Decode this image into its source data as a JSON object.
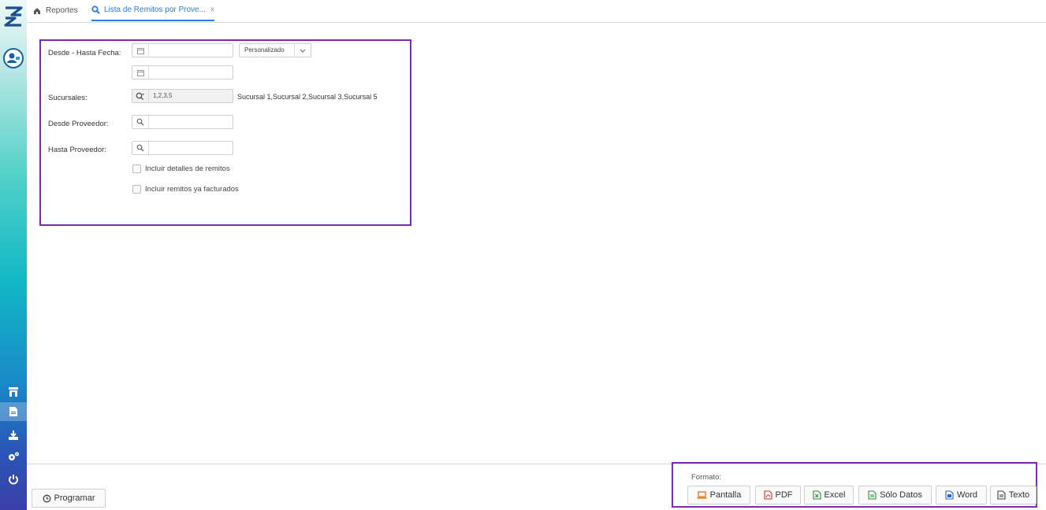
{
  "tabs": {
    "home_label": "Reportes",
    "active_label": "Lista de Remitos por Prove...",
    "close_symbol": "x"
  },
  "form": {
    "fecha_label": "Desde - Hasta Fecha:",
    "range_select_value": "Personalizado",
    "desde_fecha_value": "",
    "hasta_fecha_value": "",
    "sucursales_label": "Sucursales:",
    "sucursales_value": "1,2,3,5",
    "sucursales_desc": "Sucursal 1,Sucursal 2,Sucursal 3,Sucursal 5",
    "desde_proveedor_label": "Desde Proveedor:",
    "desde_proveedor_value": "",
    "hasta_proveedor_label": "Hasta Proveedor:",
    "hasta_proveedor_value": "",
    "chk_detalles_label": "Incluir detalles de remitos",
    "chk_facturados_label": "Incluir remitos ya facturados"
  },
  "footer": {
    "programar_label": "Programar",
    "formato_label": "Formato:",
    "formats": {
      "pantalla": "Pantalla",
      "pdf": "PDF",
      "excel": "Excel",
      "solo_datos": "Sólo Datos",
      "word": "Word",
      "texto": "Texto"
    }
  },
  "colors": {
    "accent": "#2b7fd3",
    "highlight_border": "#7b2bb0"
  }
}
